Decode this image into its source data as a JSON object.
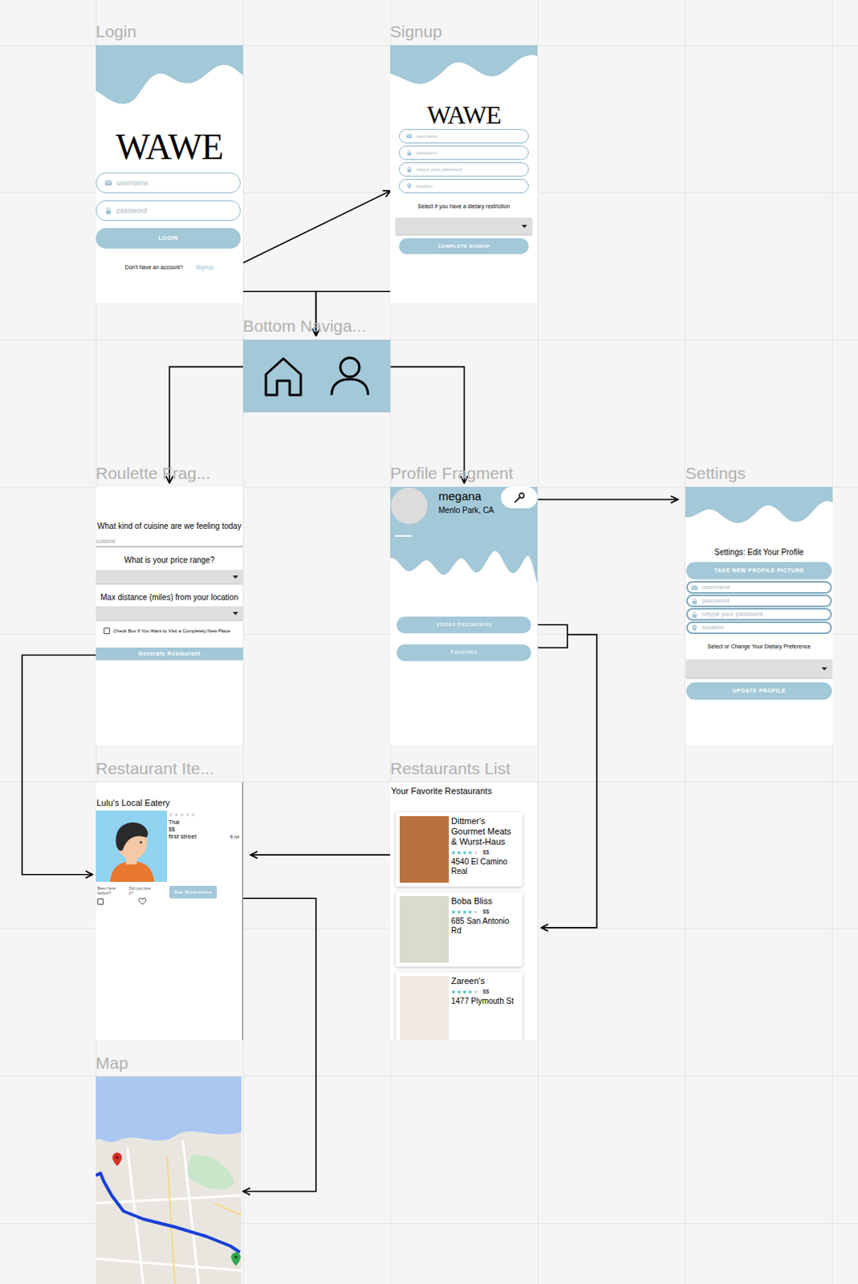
{
  "frames": [
    {
      "label": "Login",
      "kind": "login",
      "logo": "WAWE",
      "fields": [
        {
          "placeholder": "username",
          "kind": "mail"
        },
        {
          "placeholder": "password",
          "kind": "lock"
        }
      ],
      "button": "LOGIN",
      "prompt": "Don't have an account?",
      "link": "SignUp"
    },
    {
      "label": "Signup",
      "kind": "signup",
      "logo": "WAWE",
      "fields": [
        {
          "placeholder": "username",
          "kind": "mail"
        },
        {
          "placeholder": "password",
          "kind": "lock"
        },
        {
          "placeholder": "retype your password",
          "kind": "lock"
        },
        {
          "placeholder": "location",
          "kind": "pin"
        }
      ],
      "dropdown_label": "Select if you have a dietary restriction",
      "button": "COMPLETE SIGNUP"
    },
    {
      "label": "Bottom Naviga...",
      "kind": "nav",
      "items": [
        {
          "kind": "home"
        },
        {
          "kind": "profile"
        }
      ]
    },
    {
      "label": "Roulette Frag...",
      "kind": "roulette",
      "cuisine_label": "What kind of cuisine are we feeling today",
      "cuisine_placeholder": "cuisine",
      "price_label": "What is your price range?",
      "distance_label": "Max distance (miles) from your location",
      "new_place": {
        "label": "Check Box If You Want to Visit a Completely New Place",
        "checked": false
      },
      "button": "Generate Restaurant"
    },
    {
      "label": "Profile Fragment",
      "kind": "profile",
      "name": "megana",
      "location": "Menlo Park, CA",
      "buttons": [
        "Visited Restaurants",
        "Favorites"
      ]
    },
    {
      "label": "Settings",
      "kind": "settings",
      "title": "Settings: Edit Your Profile",
      "photo_button": "TAKE NEW PROFILE PICTURE",
      "fields": [
        {
          "placeholder": "username",
          "kind": "mail"
        },
        {
          "placeholder": "password",
          "kind": "lock"
        },
        {
          "placeholder": "retype your password",
          "kind": "lock"
        },
        {
          "placeholder": "location",
          "kind": "pin"
        }
      ],
      "dropdown_label": "Select or Change Your Dietary Preference",
      "button": "UPDATE PROFILE"
    },
    {
      "label": "Restaurant Ite...",
      "kind": "item",
      "name": "Lulu's Local Eatery",
      "stars": 0,
      "cuisine": "Thai",
      "price": "$$",
      "address": "first street",
      "distance": "6 mi",
      "been_label": "Been here before?",
      "been": false,
      "love_label": "Did you love it?",
      "loved": false,
      "button": "Get Directions"
    },
    {
      "label": "Restaurants List",
      "kind": "list",
      "title": "Your Favorite Restaurants",
      "items": [
        {
          "name": "Dittmer's Gourmet Meats & Wurst-Haus",
          "stars": 4,
          "price": "$$",
          "address": "4540 El Camino Real"
        },
        {
          "name": "Boba Bliss",
          "stars": 4,
          "price": "$$",
          "address": "685 San Antonio Rd"
        },
        {
          "name": "Zareen's",
          "stars": 4,
          "price": "$$",
          "address": "1477 Plymouth St"
        }
      ]
    },
    {
      "label": "Map",
      "kind": "map"
    }
  ],
  "connections": [
    {
      "from": "Login",
      "to": "Signup"
    },
    {
      "from": "Login",
      "to": "Bottom Naviga..."
    },
    {
      "from": "Signup",
      "to": "Bottom Naviga..."
    },
    {
      "from": "Bottom Naviga...",
      "to": "Roulette Frag..."
    },
    {
      "from": "Bottom Naviga...",
      "to": "Profile Fragment"
    },
    {
      "from": "Profile Fragment",
      "to": "Settings"
    },
    {
      "from": "Profile Fragment",
      "to": "Restaurants List"
    },
    {
      "from": "Roulette Frag...",
      "to": "Restaurant Ite..."
    },
    {
      "from": "Restaurants List",
      "to": "Restaurant Ite..."
    },
    {
      "from": "Restaurant Ite...",
      "to": "Map"
    }
  ]
}
